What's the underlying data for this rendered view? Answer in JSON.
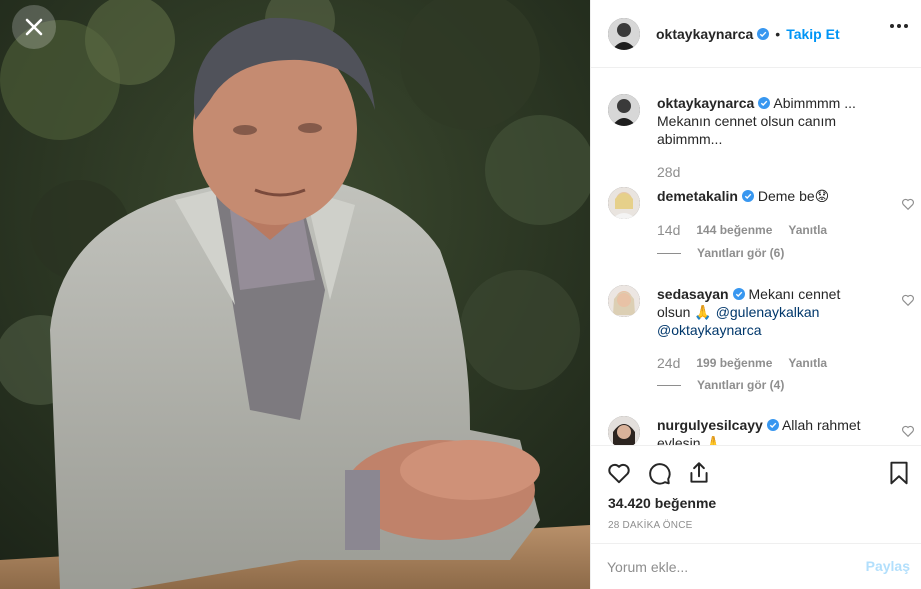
{
  "post": {
    "author": "oktaykaynarca",
    "follow_label": "Takip Et",
    "separator": "•",
    "caption": "Abimmmm ... Mekanın cennet olsun canım abimmm...",
    "caption_time": "28d"
  },
  "comments": [
    {
      "user": "demetakalin",
      "text": "Deme be😟",
      "time": "14d",
      "likes": "144 beğenme",
      "reply_label": "Yanıtla",
      "view_replies": "Yanıtları gör (6)"
    },
    {
      "user": "sedasayan",
      "text_pre": "Mekanı cennet olsun 🙏 ",
      "mention1": "@gulenaykalkan",
      "mention2": "@oktaykaynarca",
      "time": "24d",
      "likes": "199 beğenme",
      "reply_label": "Yanıtla",
      "view_replies": "Yanıtları gör (4)"
    },
    {
      "user": "nurgulyesilcayy",
      "text": "Allah rahmet eylesin 🙏"
    }
  ],
  "actions": {
    "likes": "34.420 beğenme",
    "time_ago": "28 DAKİKA ÖNCE"
  },
  "composer": {
    "placeholder": "Yorum ekle...",
    "post_label": "Paylaş"
  },
  "icons": {
    "close": "close-icon",
    "verified": "verified-badge-icon",
    "more": "more-options-icon",
    "like": "heart-icon",
    "comment": "comment-icon",
    "share": "share-icon",
    "save": "bookmark-icon"
  },
  "colors": {
    "accent": "#0095f6",
    "verified": "#3897f0",
    "muted": "#8e8e8e",
    "post_disabled": "#b2dffc"
  }
}
